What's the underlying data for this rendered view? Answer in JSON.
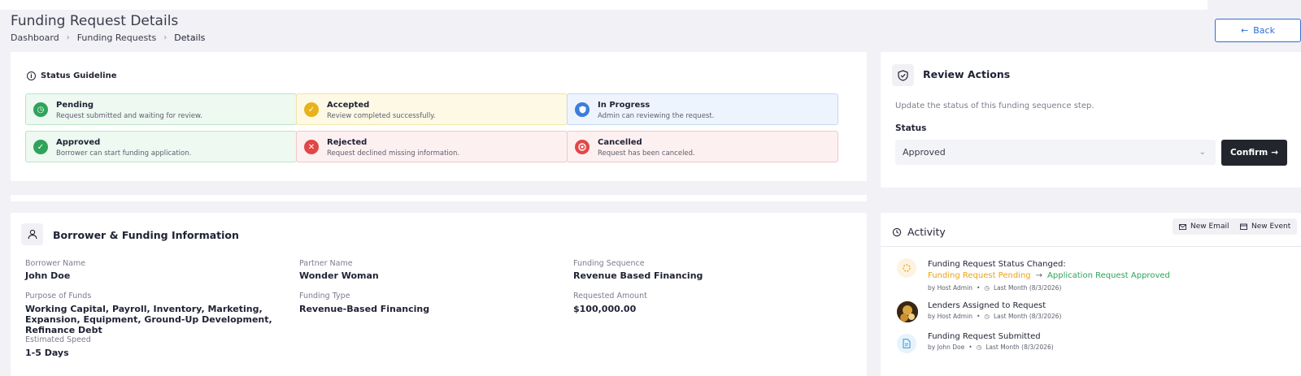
{
  "header": {
    "title": "Funding Request Details",
    "breadcrumb": [
      "Dashboard",
      "Funding Requests",
      "Details"
    ],
    "back_label": "Back",
    "back_icon": "arrow-left-icon"
  },
  "status_guideline": {
    "title": "Status Guideline",
    "items": [
      {
        "title": "Pending",
        "desc": "Request submitted and waiting for review.",
        "color": "#2fa35a",
        "icon": "clock-icon"
      },
      {
        "title": "Accepted",
        "desc": "Review completed successfully.",
        "color": "#e8b21b",
        "icon": "check-icon"
      },
      {
        "title": "In Progress",
        "desc": "Admin can reviewing the request.",
        "color": "#3b7ddd",
        "icon": "shield-icon"
      },
      {
        "title": "Approved",
        "desc": "Borrower can start funding application.",
        "color": "#2fa35a",
        "icon": "check-icon"
      },
      {
        "title": "Rejected",
        "desc": "Request declined missing information.",
        "color": "#e04848",
        "icon": "x-icon"
      },
      {
        "title": "Cancelled",
        "desc": "Request has been canceled.",
        "color": "#e04848",
        "icon": "stop-icon"
      }
    ]
  },
  "review": {
    "title": "Review Actions",
    "description": "Update the status of this funding sequence step.",
    "status_label": "Status",
    "status_value": "Approved",
    "confirm_label": "Confirm"
  },
  "borrower": {
    "title": "Borrower & Funding Information",
    "fields": [
      {
        "label": "Borrower Name",
        "value": "John Doe"
      },
      {
        "label": "Partner Name",
        "value": "Wonder Woman"
      },
      {
        "label": "Funding Sequence",
        "value": "Revenue Based Financing"
      },
      {
        "label": "Purpose of Funds",
        "value": "Working Capital, Payroll, Inventory, Marketing, Expansion, Equipment, Ground-Up Development, Refinance Debt"
      },
      {
        "label": "Funding Type",
        "value": "Revenue-Based Financing"
      },
      {
        "label": "Requested Amount",
        "value": "$100,000.00"
      },
      {
        "label": "Estimated Speed",
        "value": "1-5 Days"
      }
    ]
  },
  "activity": {
    "title": "Activity",
    "new_email_label": "New Email",
    "new_event_label": "New Event",
    "items": [
      {
        "title": "Funding Request Status Changed:",
        "from": "Funding Request Pending",
        "arrow": "→",
        "to": "Application Request Approved",
        "by": "by Host Admin",
        "time": "Last Month (8/3/2026)",
        "from_color": "#e8a317",
        "to_color": "#2fa35a"
      },
      {
        "title": "Lenders Assigned to Request",
        "by": "by Host Admin",
        "time": "Last Month (8/3/2026)"
      },
      {
        "title": "Funding Request Submitted",
        "by": "by John Doe",
        "time": "Last Month (8/3/2026)"
      }
    ]
  }
}
